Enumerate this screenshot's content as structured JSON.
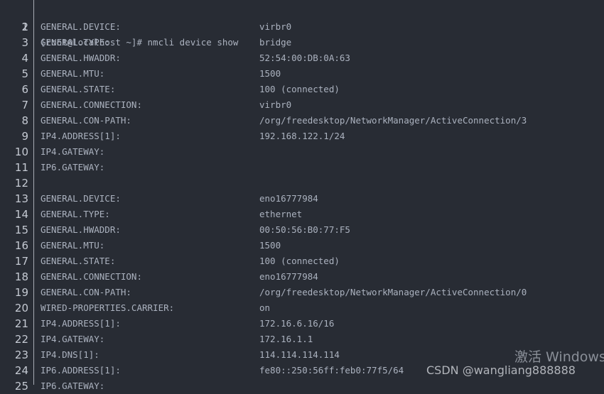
{
  "terminal": {
    "command": "[root@localhost ~]# nmcli device show",
    "lines": [
      {
        "key": "GENERAL.DEVICE:",
        "value": "virbr0"
      },
      {
        "key": "GENERAL.TYPE:",
        "value": "bridge"
      },
      {
        "key": "GENERAL.HWADDR:",
        "value": "52:54:00:DB:0A:63"
      },
      {
        "key": "GENERAL.MTU:",
        "value": "1500"
      },
      {
        "key": "GENERAL.STATE:",
        "value": "100 (connected)"
      },
      {
        "key": "GENERAL.CONNECTION:",
        "value": "virbr0"
      },
      {
        "key": "GENERAL.CON-PATH:",
        "value": "/org/freedesktop/NetworkManager/ActiveConnection/3"
      },
      {
        "key": "IP4.ADDRESS[1]:",
        "value": "192.168.122.1/24"
      },
      {
        "key": "IP4.GATEWAY:",
        "value": ""
      },
      {
        "key": "IP6.GATEWAY:",
        "value": ""
      },
      {
        "key": "",
        "value": ""
      },
      {
        "key": "GENERAL.DEVICE:",
        "value": "eno16777984"
      },
      {
        "key": "GENERAL.TYPE:",
        "value": "ethernet"
      },
      {
        "key": "GENERAL.HWADDR:",
        "value": "00:50:56:B0:77:F5"
      },
      {
        "key": "GENERAL.MTU:",
        "value": "1500"
      },
      {
        "key": "GENERAL.STATE:",
        "value": "100 (connected)"
      },
      {
        "key": "GENERAL.CONNECTION:",
        "value": "eno16777984"
      },
      {
        "key": "GENERAL.CON-PATH:",
        "value": "/org/freedesktop/NetworkManager/ActiveConnection/0"
      },
      {
        "key": "WIRED-PROPERTIES.CARRIER:",
        "value": "on"
      },
      {
        "key": "IP4.ADDRESS[1]:",
        "value": "172.16.6.16/16"
      },
      {
        "key": "IP4.GATEWAY:",
        "value": "172.16.1.1"
      },
      {
        "key": "IP4.DNS[1]:",
        "value": "114.114.114.114"
      },
      {
        "key": "IP6.ADDRESS[1]:",
        "value": "fe80::250:56ff:feb0:77f5/64"
      },
      {
        "key": "IP6.GATEWAY:",
        "value": ""
      }
    ]
  },
  "watermarks": {
    "windows": "激活 Windows",
    "csdn": "CSDN @wangliang888888"
  }
}
